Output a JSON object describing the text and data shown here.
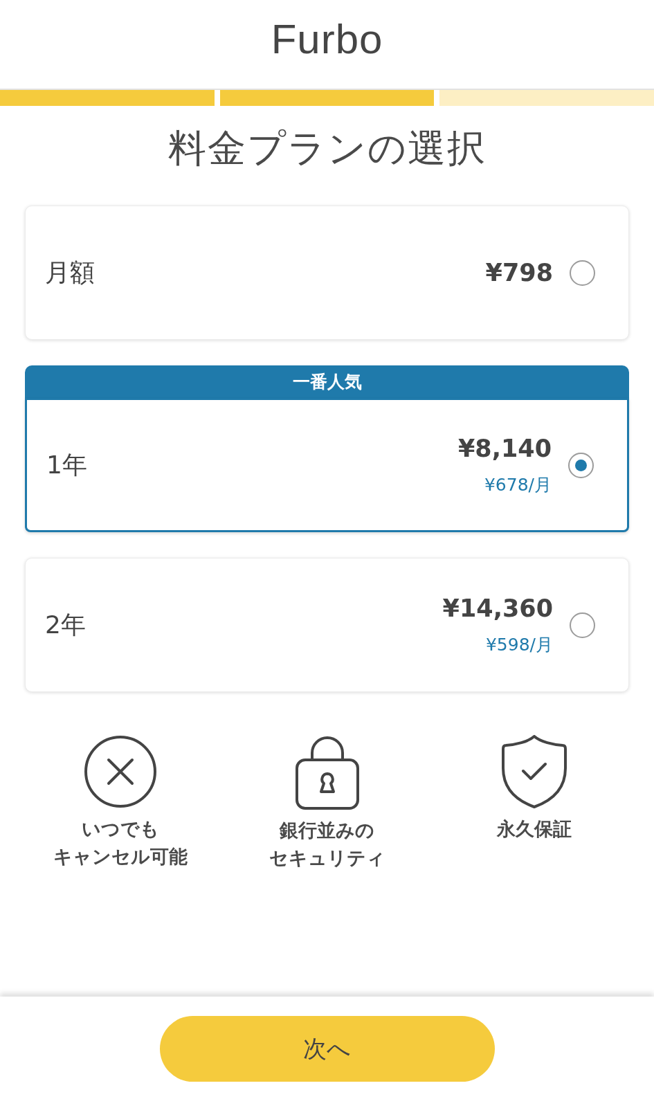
{
  "header": {
    "logo": "Furbo"
  },
  "progress": [
    {
      "completed": true
    },
    {
      "completed": true
    },
    {
      "completed": false
    }
  ],
  "title": "料金プランの選択",
  "plans": [
    {
      "name": "月額",
      "price": "¥798",
      "selected": false
    },
    {
      "badge": "一番人気",
      "name": "1年",
      "price": "¥8,140",
      "per_month": "¥678/月",
      "selected": true
    },
    {
      "name": "2年",
      "price": "¥14,360",
      "per_month": "¥598/月",
      "selected": false
    }
  ],
  "features": [
    {
      "kind": "cancel",
      "lines": [
        "いつでも",
        "キャンセル可能"
      ]
    },
    {
      "kind": "security",
      "lines": [
        "銀行並みの",
        "セキュリティ"
      ]
    },
    {
      "kind": "guarantee",
      "lines": [
        "永久保証"
      ]
    }
  ],
  "next_button": {
    "label": "次へ"
  }
}
